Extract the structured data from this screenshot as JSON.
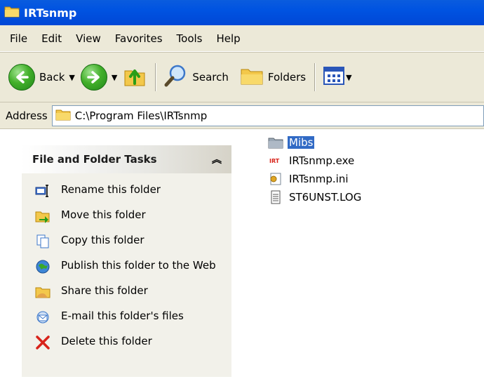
{
  "window": {
    "title": "IRTsnmp"
  },
  "menu": [
    "File",
    "Edit",
    "View",
    "Favorites",
    "Tools",
    "Help"
  ],
  "toolbar": {
    "back_label": "Back",
    "search_label": "Search",
    "folders_label": "Folders"
  },
  "address": {
    "label": "Address",
    "path": "C:\\Program Files\\IRTsnmp"
  },
  "task_pane": {
    "title": "File and Folder Tasks",
    "items": [
      {
        "label": "Rename this folder",
        "icon": "rename-icon"
      },
      {
        "label": "Move this folder",
        "icon": "move-icon"
      },
      {
        "label": "Copy this folder",
        "icon": "copy-icon"
      },
      {
        "label": "Publish this folder to the Web",
        "icon": "publish-web-icon"
      },
      {
        "label": "Share this folder",
        "icon": "share-icon"
      },
      {
        "label": "E-mail this folder's files",
        "icon": "email-icon"
      },
      {
        "label": "Delete this folder",
        "icon": "delete-icon"
      }
    ]
  },
  "files": [
    {
      "name": "Mibs",
      "icon": "folder-icon",
      "selected": true
    },
    {
      "name": "IRTsnmp.exe",
      "icon": "exe-icon",
      "selected": false
    },
    {
      "name": "IRTsnmp.ini",
      "icon": "ini-icon",
      "selected": false
    },
    {
      "name": "ST6UNST.LOG",
      "icon": "log-icon",
      "selected": false
    }
  ],
  "colors": {
    "titlebar": "#0053e1",
    "toolbar_bg": "#ece9d8",
    "selection": "#316ac5"
  }
}
